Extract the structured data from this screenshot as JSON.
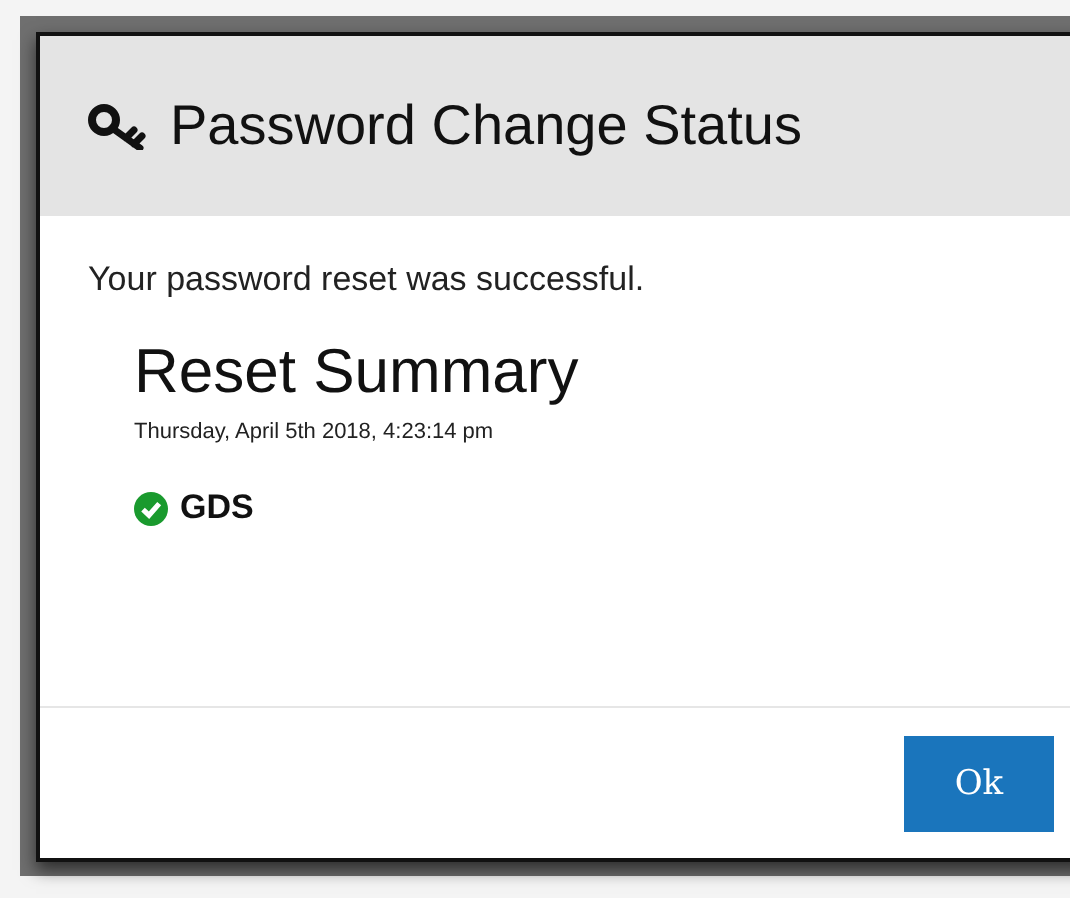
{
  "dialog": {
    "title": "Password Change Status",
    "message": "Your password reset was successful.",
    "summary": {
      "heading": "Reset Summary",
      "timestamp": "Thursday, April 5th 2018, 4:23:14 pm",
      "systems": [
        {
          "name": "GDS",
          "success": true
        }
      ]
    },
    "buttons": [
      "Ok"
    ]
  }
}
